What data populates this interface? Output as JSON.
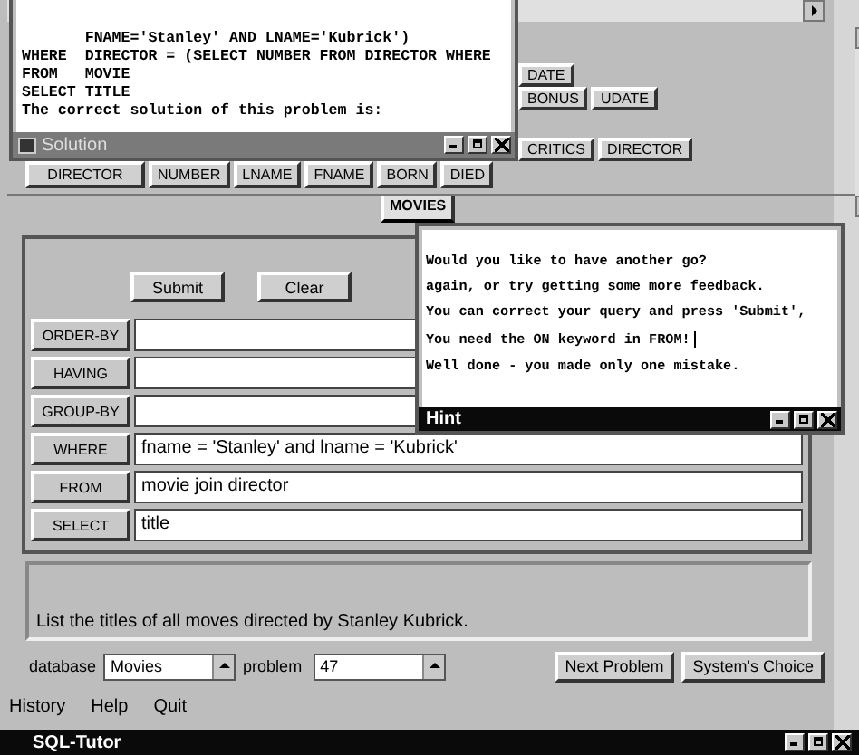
{
  "solution_window": {
    "lines": [
      "       FNAME='Stanley' AND LNAME='Kubrick')",
      "WHERE  DIRECTOR = (SELECT NUMBER FROM DIRECTOR WHERE",
      "FROM   MOVIE",
      "SELECT TITLE",
      "The correct solution of this problem is:"
    ],
    "title": "Solution"
  },
  "schema": {
    "other_rows": [
      [
        "DATE"
      ],
      [
        "BONUS",
        "UDATE"
      ],
      [
        "CRITICS",
        "DIRECTOR"
      ]
    ],
    "attributes": [
      "DIRECTOR",
      "NUMBER",
      "LNAME",
      "FNAME",
      "BORN",
      "DIED"
    ],
    "tables": [
      {
        "label": "MOVIES",
        "selected": true
      }
    ]
  },
  "hint_window": {
    "lines": [
      "Would you like to have another go?",
      "again, or try getting some more feedback.",
      "You can correct your query and press 'Submit',",
      "You need the ON keyword in FROM!",
      "Well done - you made only one mistake."
    ],
    "title": "Hint"
  },
  "query_buttons": [
    "Submit",
    "Clear"
  ],
  "clauses": [
    {
      "label": "ORDER-BY"
    },
    {
      "label": "HAVING"
    },
    {
      "label": "GROUP-BY"
    },
    {
      "label": "WHERE",
      "value": "fname = 'Stanley' and lname = 'Kubrick'"
    },
    {
      "label": "FROM",
      "value": "movie join director"
    },
    {
      "label": "SELECT",
      "value": "title"
    }
  ],
  "problem_text": "List the titles of all moves directed by Stanley Kubrick.",
  "controls": {
    "database_label": "database",
    "database": "Movies",
    "problem_label": "problem",
    "problem": "47",
    "buttons": [
      "Next Problem",
      "System's Choice"
    ]
  },
  "menu": [
    "History",
    "Help",
    "Quit"
  ],
  "window": {
    "title": "SQL-Tutor"
  }
}
